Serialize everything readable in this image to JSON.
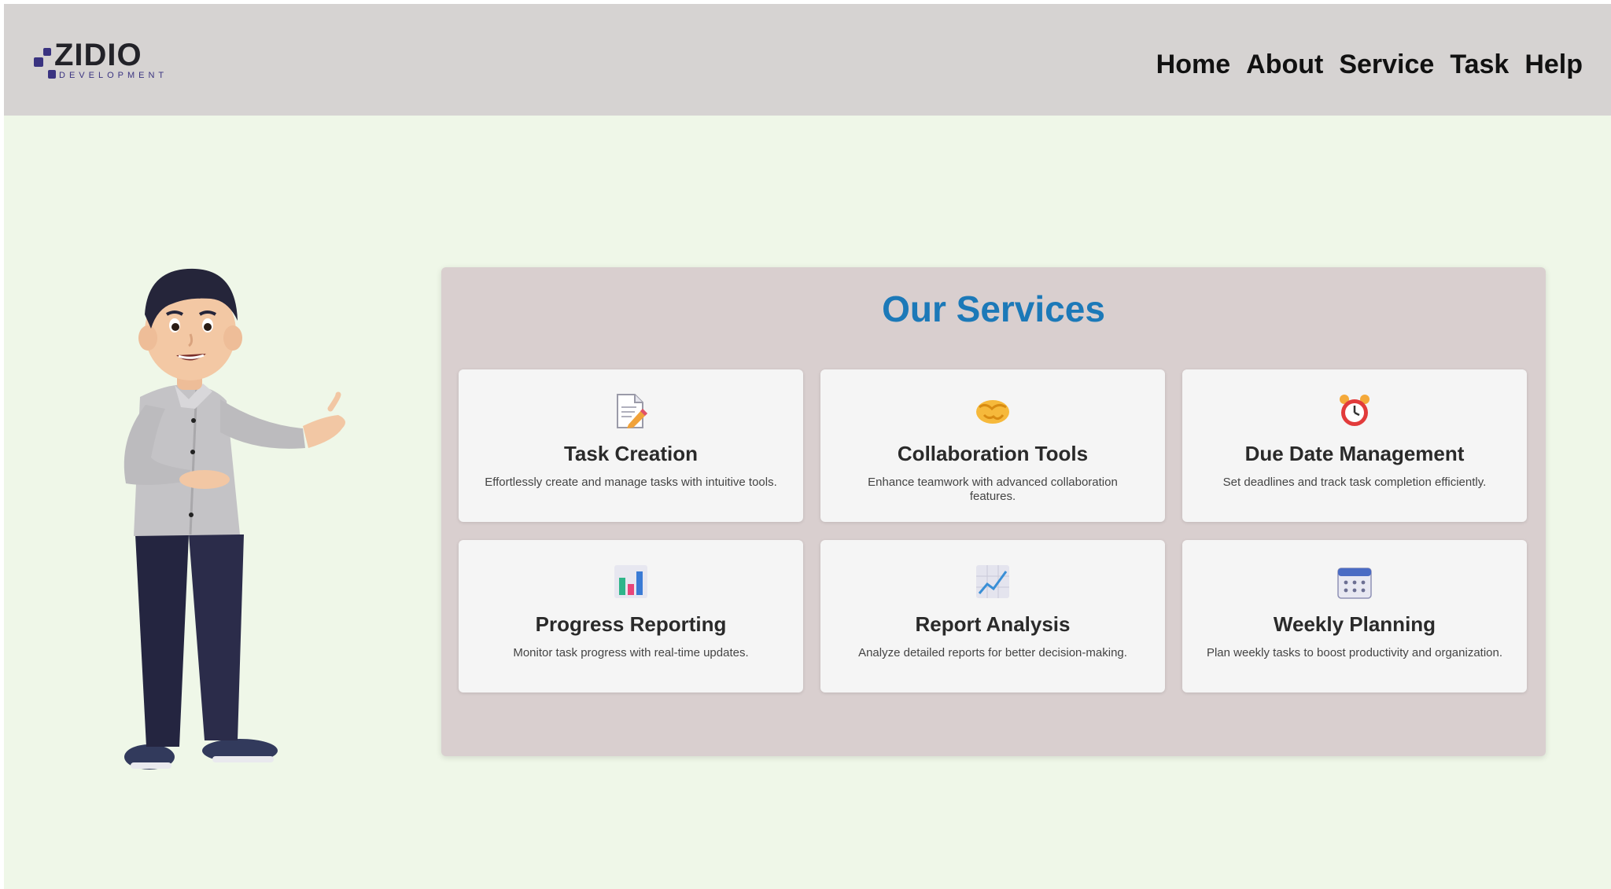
{
  "logo": {
    "brand": "ZIDIO",
    "tagline": "DEVELOPMENT"
  },
  "nav": {
    "items": [
      {
        "label": "Home"
      },
      {
        "label": "About"
      },
      {
        "label": "Service"
      },
      {
        "label": "Task"
      },
      {
        "label": "Help"
      }
    ]
  },
  "services": {
    "title": "Our Services",
    "cards": [
      {
        "icon": "memo-pencil-icon",
        "title": "Task Creation",
        "description": "Effortlessly create and manage tasks with intuitive tools."
      },
      {
        "icon": "handshake-icon",
        "title": "Collaboration Tools",
        "description": "Enhance teamwork with advanced collaboration features."
      },
      {
        "icon": "alarm-clock-icon",
        "title": "Due Date Management",
        "description": "Set deadlines and track task completion efficiently."
      },
      {
        "icon": "bar-chart-icon",
        "title": "Progress Reporting",
        "description": "Monitor task progress with real-time updates."
      },
      {
        "icon": "trend-chart-icon",
        "title": "Report Analysis",
        "description": "Analyze detailed reports for better decision-making."
      },
      {
        "icon": "calendar-icon",
        "title": "Weekly Planning",
        "description": "Plan weekly tasks to boost productivity and organization."
      }
    ]
  },
  "colors": {
    "header_bg": "#d6d3d2",
    "page_bg": "#eff7e8",
    "panel_bg": "#d9cfcf",
    "card_bg": "#f5f5f5",
    "title_accent": "#1c79b8",
    "logo_brand": "#3a3380"
  }
}
